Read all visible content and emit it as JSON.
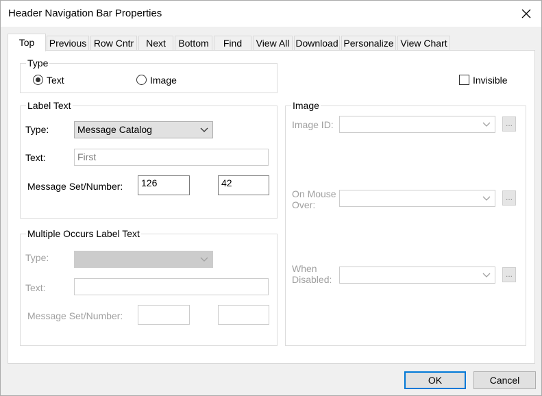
{
  "window": {
    "title": "Header Navigation Bar Properties"
  },
  "tabs": [
    {
      "label": "Top",
      "active": true
    },
    {
      "label": "Previous"
    },
    {
      "label": "Row Cntr"
    },
    {
      "label": "Next"
    },
    {
      "label": "Bottom"
    },
    {
      "label": "Find"
    },
    {
      "label": "View All"
    },
    {
      "label": "Download"
    },
    {
      "label": "Personalize"
    },
    {
      "label": "View Chart"
    }
  ],
  "type_group": {
    "label": "Type",
    "text_option": "Text",
    "image_option": "Image",
    "selected": "Text"
  },
  "invisible": {
    "label": "Invisible",
    "checked": false
  },
  "label_text": {
    "group_label": "Label Text",
    "type_label": "Type:",
    "type_value": "Message Catalog",
    "text_label": "Text:",
    "text_value": "First",
    "msg_label": "Message Set/Number:",
    "msg_set": "126",
    "msg_number": "42"
  },
  "multiple_occurs": {
    "group_label": "Multiple Occurs Label Text",
    "type_label": "Type:",
    "type_value": "",
    "text_label": "Text:",
    "text_value": "",
    "msg_label": "Message Set/Number:",
    "msg_set": "",
    "msg_number": ""
  },
  "image_group": {
    "group_label": "Image",
    "image_id_label": "Image ID:",
    "mouse_over_label_1": "On Mouse",
    "mouse_over_label_2": "Over:",
    "when_disabled_label_1": "When",
    "when_disabled_label_2": "Disabled:",
    "ellipsis": "..."
  },
  "buttons": {
    "ok": "OK",
    "cancel": "Cancel"
  }
}
